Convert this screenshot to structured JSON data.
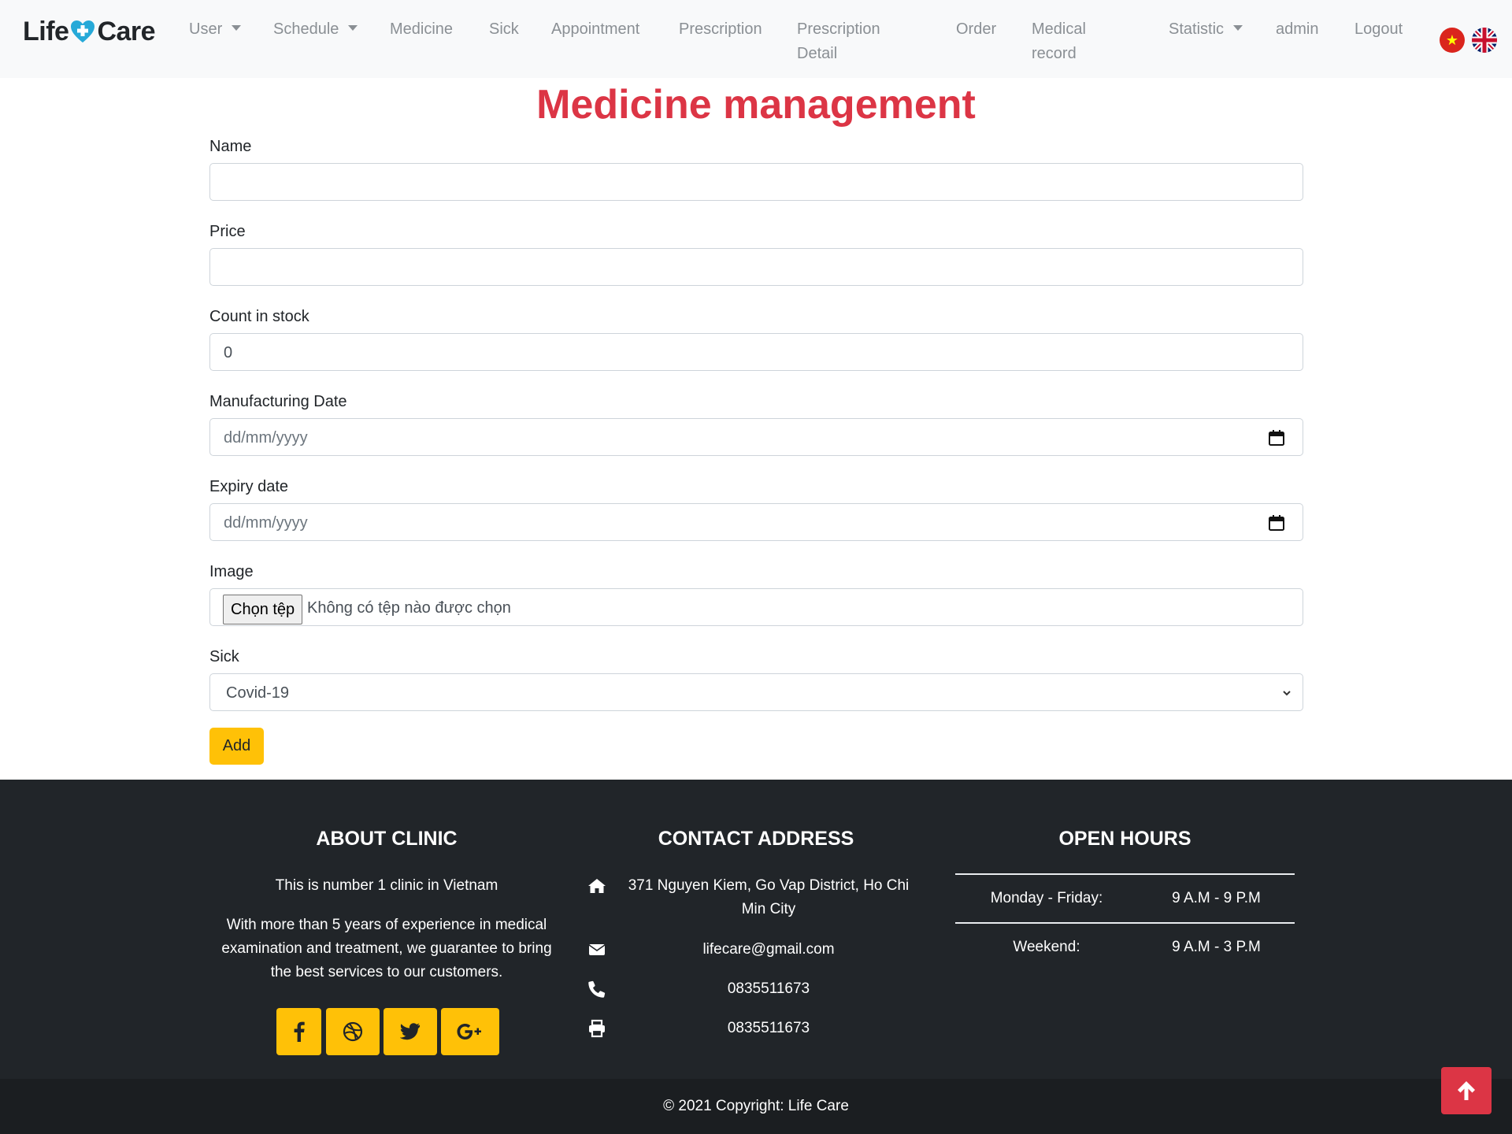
{
  "brand": {
    "left": "Life",
    "right": "Care"
  },
  "nav": {
    "user": "User",
    "schedule": "Schedule",
    "medicine": "Medicine",
    "sick": "Sick",
    "appointment": "Appointment",
    "prescription": "Prescription",
    "prescription_detail": "Prescription Detail",
    "order": "Order",
    "medical_record": "Medical record",
    "statistic": "Statistic",
    "admin": "admin",
    "logout": "Logout"
  },
  "page": {
    "title": "Medicine management"
  },
  "form": {
    "name_label": "Name",
    "name_value": "",
    "price_label": "Price",
    "price_value": "",
    "stock_label": "Count in stock",
    "stock_value": "0",
    "mfg_label": "Manufacturing Date",
    "mfg_placeholder": "dd/mm/yyyy",
    "expiry_label": "Expiry date",
    "expiry_placeholder": "dd/mm/yyyy",
    "image_label": "Image",
    "file_button": "Chọn tệp",
    "file_status": "Không có tệp nào được chọn",
    "sick_label": "Sick",
    "sick_selected": "Covid-19",
    "submit": "Add"
  },
  "footer": {
    "about": {
      "title": "ABOUT CLINIC",
      "line1": "This is number 1 clinic in Vietnam",
      "line2": "With more than 5 years of experience in medical examination and treatment, we guarantee to bring the best services to our customers."
    },
    "contact": {
      "title": "CONTACT ADDRESS",
      "address": "371 Nguyen Kiem, Go Vap District, Ho Chi Min City",
      "email": "lifecare@gmail.com",
      "phone": "0835511673",
      "fax": "0835511673"
    },
    "hours": {
      "title": "OPEN HOURS",
      "weekday_label": "Monday - Friday:",
      "weekday_value": "9 A.M - 9 P.M",
      "weekend_label": "Weekend:",
      "weekend_value": "9 A.M - 3 P.M"
    },
    "copyright": "© 2021 Copyright: Life Care"
  },
  "colors": {
    "accent": "#dc3545",
    "button": "#ffc107",
    "footer": "#212529",
    "navbar": "#f8f9fa"
  },
  "icons": [
    "facebook-icon",
    "dribbble-icon",
    "twitter-icon",
    "google-plus-icon",
    "home-icon",
    "envelope-icon",
    "phone-icon",
    "print-icon",
    "calendar-icon",
    "arrow-up-icon"
  ]
}
